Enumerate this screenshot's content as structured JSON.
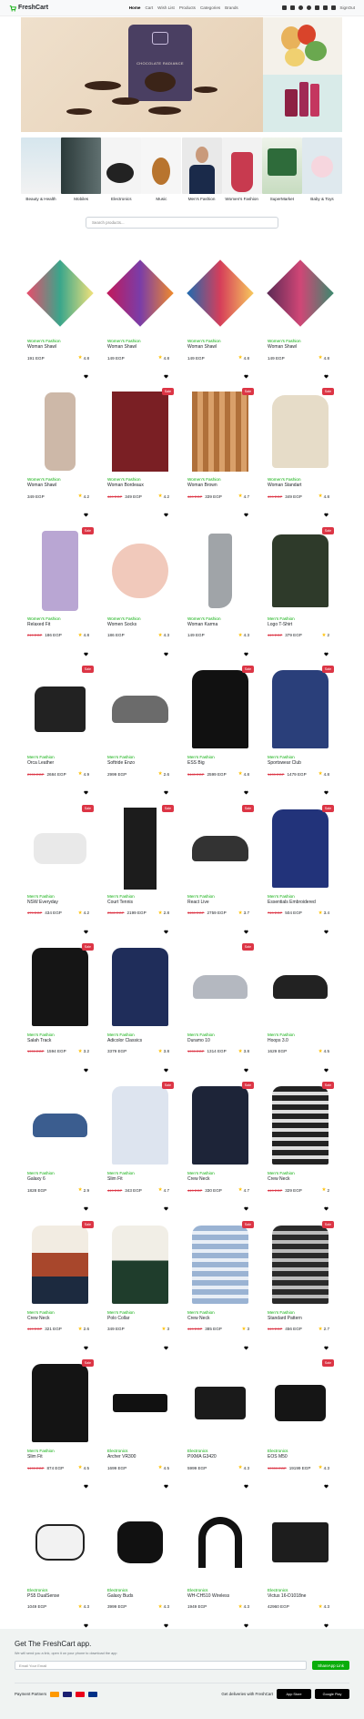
{
  "nav": {
    "brand": "FreshCart",
    "links": [
      "Home",
      "Cart",
      "Wish List",
      "Products",
      "Categories",
      "Brands"
    ],
    "signout": "SignOut"
  },
  "hero": {
    "product_text": "CHOCOLATE RADIANCE"
  },
  "categories": [
    {
      "label": "Beauty & Health"
    },
    {
      "label": "Mobiles"
    },
    {
      "label": "Electronics"
    },
    {
      "label": "Music"
    },
    {
      "label": "Men's Fashion"
    },
    {
      "label": "Women's Fashion"
    },
    {
      "label": "SuperMarket"
    },
    {
      "label": "Baby & Toys"
    }
  ],
  "search": {
    "placeholder": "Search products..."
  },
  "sale_label": "Sale",
  "products": [
    {
      "cat": "Women's Fashion",
      "name": "Woman Shawl",
      "price": "191 EGP",
      "old": "",
      "rating": "4.8",
      "sale": false,
      "kind": "scarf1"
    },
    {
      "cat": "Women's Fashion",
      "name": "Woman Shawl",
      "price": "149 EGP",
      "old": "",
      "rating": "4.8",
      "sale": false,
      "kind": "scarf2"
    },
    {
      "cat": "Women's Fashion",
      "name": "Woman Shawl",
      "price": "149 EGP",
      "old": "",
      "rating": "4.8",
      "sale": false,
      "kind": "scarf3"
    },
    {
      "cat": "Women's Fashion",
      "name": "Woman Shawl",
      "price": "149 EGP",
      "old": "",
      "rating": "4.8",
      "sale": false,
      "kind": "scarf4"
    },
    {
      "cat": "Women's Fashion",
      "name": "Woman Shawl",
      "price": "349 EGP",
      "old": "",
      "rating": "4.2",
      "sale": false,
      "kind": "beige"
    },
    {
      "cat": "Women's Fashion",
      "name": "Woman Bordeaux",
      "price": "349 EGP",
      "old": "469 EGP",
      "rating": "4.2",
      "sale": true,
      "kind": "burg"
    },
    {
      "cat": "Women's Fashion",
      "name": "Woman Brown",
      "price": "339 EGP",
      "old": "469 EGP",
      "rating": "4.7",
      "sale": true,
      "kind": "plaid"
    },
    {
      "cat": "Women's Fashion",
      "name": "Woman Standart",
      "price": "349 EGP",
      "old": "499 EGP",
      "rating": "4.8",
      "sale": true,
      "kind": "hood"
    },
    {
      "cat": "Women's Fashion",
      "name": "Relaxed Fit",
      "price": "186 EGP",
      "old": "249 EGP",
      "rating": "4.8",
      "sale": true,
      "kind": "lilac"
    },
    {
      "cat": "Women's Fashion",
      "name": "Women Socks",
      "price": "186 EGP",
      "old": "",
      "rating": "4.3",
      "sale": false,
      "kind": "slip"
    },
    {
      "cat": "Women's Fashion",
      "name": "Woman Karma",
      "price": "149 EGP",
      "old": "",
      "rating": "4.3",
      "sale": false,
      "kind": "sock"
    },
    {
      "cat": "Men's Fashion",
      "name": "Logo T-Shirt",
      "price": "379 EGP",
      "old": "449 EGP",
      "rating": "2",
      "sale": true,
      "kind": "jj"
    },
    {
      "cat": "Men's Fashion",
      "name": "Orca Leather",
      "price": "2684 EGP",
      "old": "2999 EGP",
      "rating": "4.9",
      "sale": true,
      "kind": "boot"
    },
    {
      "cat": "Men's Fashion",
      "name": "Softride Enzo",
      "price": "2999 EGP",
      "old": "",
      "rating": "2.6",
      "sale": false,
      "kind": "shoe"
    },
    {
      "cat": "Men's Fashion",
      "name": "ESS Big",
      "price": "2599 EGP",
      "old": "3449 EGP",
      "rating": "4.8",
      "sale": true,
      "kind": "puma"
    },
    {
      "cat": "Men's Fashion",
      "name": "Sportswear Club",
      "price": "1479 EGP",
      "old": "1499 EGP",
      "rating": "4.8",
      "sale": true,
      "kind": "nike"
    },
    {
      "cat": "Men's Fashion",
      "name": "NSW Everyday",
      "price": "434 EGP",
      "old": "479 EGP",
      "rating": "4.2",
      "sale": true,
      "kind": "socks"
    },
    {
      "cat": "Men's Fashion",
      "name": "Court Tennis",
      "price": "2199 EGP",
      "old": "2349 EGP",
      "rating": "2.8",
      "sale": true,
      "kind": "pants"
    },
    {
      "cat": "Men's Fashion",
      "name": "React Live",
      "price": "2759 EGP",
      "old": "3459 EGP",
      "rating": "3.7",
      "sale": true,
      "kind": "react"
    },
    {
      "cat": "Men's Fashion",
      "name": "Essentials Embroidered",
      "price": "504 EGP",
      "old": "749 EGP",
      "rating": "3.4",
      "sale": true,
      "kind": "adidas"
    },
    {
      "cat": "Men's Fashion",
      "name": "Salah Track",
      "price": "1594 EGP",
      "old": "1999 EGP",
      "rating": "3.2",
      "sale": true,
      "kind": "track"
    },
    {
      "cat": "Men's Fashion",
      "name": "Adicolor Classics",
      "price": "3379 EGP",
      "old": "",
      "rating": "3.8",
      "sale": false,
      "kind": "adiclass"
    },
    {
      "cat": "Men's Fashion",
      "name": "Duramo 10",
      "price": "1314 EGP",
      "old": "1999 EGP",
      "rating": "3.8",
      "sale": true,
      "kind": "duramo"
    },
    {
      "cat": "Men's Fashion",
      "name": "Hoops 3.0",
      "price": "1629 EGP",
      "old": "",
      "rating": "4.5",
      "sale": false,
      "kind": "hoops"
    },
    {
      "cat": "Men's Fashion",
      "name": "Galaxy 6",
      "price": "1828 EGP",
      "old": "",
      "rating": "2.9",
      "sale": false,
      "kind": "galaxy"
    },
    {
      "cat": "Men's Fashion",
      "name": "Slim Fit",
      "price": "343 EGP",
      "old": "449 EGP",
      "rating": "4.7",
      "sale": true,
      "kind": "shirt"
    },
    {
      "cat": "Men's Fashion",
      "name": "Crew Neck",
      "price": "330 EGP",
      "old": "449 EGP",
      "rating": "4.7",
      "sale": true,
      "kind": "navy"
    },
    {
      "cat": "Men's Fashion",
      "name": "Crew Neck",
      "price": "329 EGP",
      "old": "449 EGP",
      "rating": "2",
      "sale": true,
      "kind": "stripe"
    },
    {
      "cat": "Men's Fashion",
      "name": "Crew Neck",
      "price": "321 EGP",
      "old": "449 EGP",
      "rating": "2.6",
      "sale": true,
      "kind": "colorb"
    },
    {
      "cat": "Men's Fashion",
      "name": "Polo Collar",
      "price": "349 EGP",
      "old": "",
      "rating": "3",
      "sale": false,
      "kind": "polo"
    },
    {
      "cat": "Men's Fashion",
      "name": "Crew Neck",
      "price": "385 EGP",
      "old": "449 EGP",
      "rating": "3",
      "sale": true,
      "kind": "blue"
    },
    {
      "cat": "Men's Fashion",
      "name": "Standard Pattern",
      "price": "456 EGP",
      "old": "549 EGP",
      "rating": "2.7",
      "sale": true,
      "kind": "std"
    },
    {
      "cat": "Men's Fashion",
      "name": "Slim Fit",
      "price": "874 EGP",
      "old": "1499 EGP",
      "rating": "4.5",
      "sale": true,
      "kind": "leather"
    },
    {
      "cat": "Electronics",
      "name": "Archer VR300",
      "price": "1699 EGP",
      "old": "",
      "rating": "4.5",
      "sale": false,
      "kind": "router"
    },
    {
      "cat": "Electronics",
      "name": "PIXMA G3420",
      "price": "5999 EGP",
      "old": "",
      "rating": "4.3",
      "sale": false,
      "kind": "printer"
    },
    {
      "cat": "Electronics",
      "name": "EOS M50",
      "price": "19199 EGP",
      "old": "19999 EGP",
      "rating": "4.3",
      "sale": true,
      "kind": "camera"
    },
    {
      "cat": "Electronics",
      "name": "PS5 DualSense",
      "price": "1049 EGP",
      "old": "",
      "rating": "4.3",
      "sale": false,
      "kind": "ps5"
    },
    {
      "cat": "Electronics",
      "name": "Galaxy Buds",
      "price": "3999 EGP",
      "old": "",
      "rating": "4.3",
      "sale": false,
      "kind": "buds"
    },
    {
      "cat": "Electronics",
      "name": "WH-CH510 Wireless",
      "price": "1949 EGP",
      "old": "",
      "rating": "4.3",
      "sale": false,
      "kind": "phones"
    },
    {
      "cat": "Electronics",
      "name": "Victus 16-D1018ne",
      "price": "42960 EGP",
      "old": "",
      "rating": "4.3",
      "sale": false,
      "kind": "laptop"
    }
  ],
  "footer": {
    "title": "Get The FreshCart app.",
    "subtitle": "We will send you a link, open it on your phone to download the app",
    "email_placeholder": "Email Your Email",
    "share_button": "ShareApp Link",
    "payment_label": "Payment Partners",
    "deliveries_label": "Get deliveries with FreshCart",
    "appstore": "App Store",
    "googleplay": "Google Play"
  },
  "colors": {
    "accent": "#0aad0a",
    "sale": "#dc3545",
    "star": "#ffc107"
  }
}
